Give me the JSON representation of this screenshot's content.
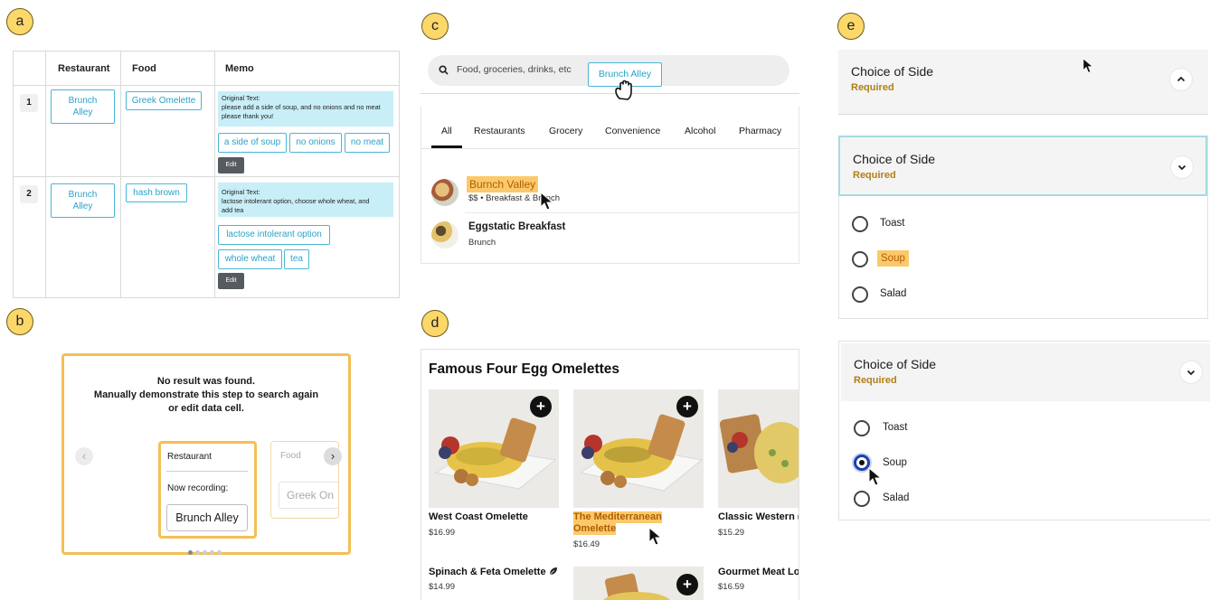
{
  "badges": {
    "a": "a",
    "b": "b",
    "c": "c",
    "d": "d",
    "e": "e"
  },
  "table": {
    "headers": {
      "restaurant": "Restaurant",
      "food": "Food",
      "memo": "Memo"
    },
    "rows": [
      {
        "num": "1",
        "restaurant_line1": "Brunch",
        "restaurant_line2": "Alley",
        "food": "Greek Omelette",
        "memo_label": "Original Text:",
        "memo_line1": "please add a side of soup, and no onions and no meat",
        "memo_line2": "please thank you!",
        "chips": [
          "a side of soup",
          "no onions",
          "no meat"
        ],
        "edit": "Edit"
      },
      {
        "num": "2",
        "restaurant_line1": "Brunch",
        "restaurant_line2": "Alley",
        "food": "hash brown",
        "memo_label": "Original Text:",
        "memo_line1": "lactose intolerant option, choose whole wheat, and",
        "memo_line2": "add tea",
        "chips": [
          "lactose intolerant option",
          "whole wheat",
          "tea"
        ],
        "edit": "Edit"
      }
    ]
  },
  "no_result": {
    "line1": "No result was found.",
    "line2": "Manually demonstrate this step to search again",
    "line3": "or edit data cell.",
    "card_field": "Restaurant",
    "card_status": "Now recording:",
    "card_value": "Brunch Alley",
    "next_field": "Food",
    "next_value": "Greek On",
    "prev_icon": "chevron-left-icon",
    "next_icon": "chevron-right-icon",
    "page_count": 5,
    "page_active": 1
  },
  "search": {
    "placeholder": "Food, groceries, drinks, etc",
    "dragged_value": "Brunch Alley",
    "tabs": [
      "All",
      "Restaurants",
      "Grocery",
      "Convenience",
      "Alcohol",
      "Pharmacy"
    ],
    "active_tab": "All",
    "results": [
      {
        "name": "Burnch Valley",
        "sub": "$$ • Breakfast & Brunch",
        "highlight": true
      },
      {
        "name": "Eggstatic Breakfast",
        "sub": "Brunch",
        "highlight": false
      }
    ]
  },
  "menu": {
    "section_title": "Famous Four Egg Omelettes",
    "items": [
      {
        "name": "West Coast Omelette",
        "price": "$16.99"
      },
      {
        "name_line1": "The Mediterranean",
        "name_line2": "Omelette",
        "price": "$16.49",
        "highlight": true
      },
      {
        "name": "Classic Western (",
        "price": "$15.29"
      },
      {
        "name": "Spinach & Feta Omelette",
        "price": "$14.99",
        "icon": "leaf-icon"
      },
      {
        "name": "",
        "price": ""
      },
      {
        "name": "Gourmet Meat Lo",
        "price": "$16.59"
      }
    ],
    "add_icon": "plus-icon"
  },
  "options": {
    "panels": [
      {
        "title": "Choice of Side",
        "required": "Required",
        "chevron": "chevron-up-icon"
      },
      {
        "title": "Choice of Side",
        "required": "Required",
        "chevron": "chevron-down-icon",
        "choices": [
          "Toast",
          "Soup",
          "Salad"
        ],
        "highlight": "Soup"
      },
      {
        "title": "Choice of Side",
        "required": "Required",
        "chevron": "chevron-down-icon",
        "choices": [
          "Toast",
          "Soup",
          "Salad"
        ],
        "selected": "Soup"
      }
    ]
  },
  "colors": {
    "accent_blue": "#2aa2c8",
    "memo_bg": "#c8eef7",
    "highlight": "#fbc96b",
    "badge": "#fcd86a",
    "required_text": "#b27e15"
  }
}
